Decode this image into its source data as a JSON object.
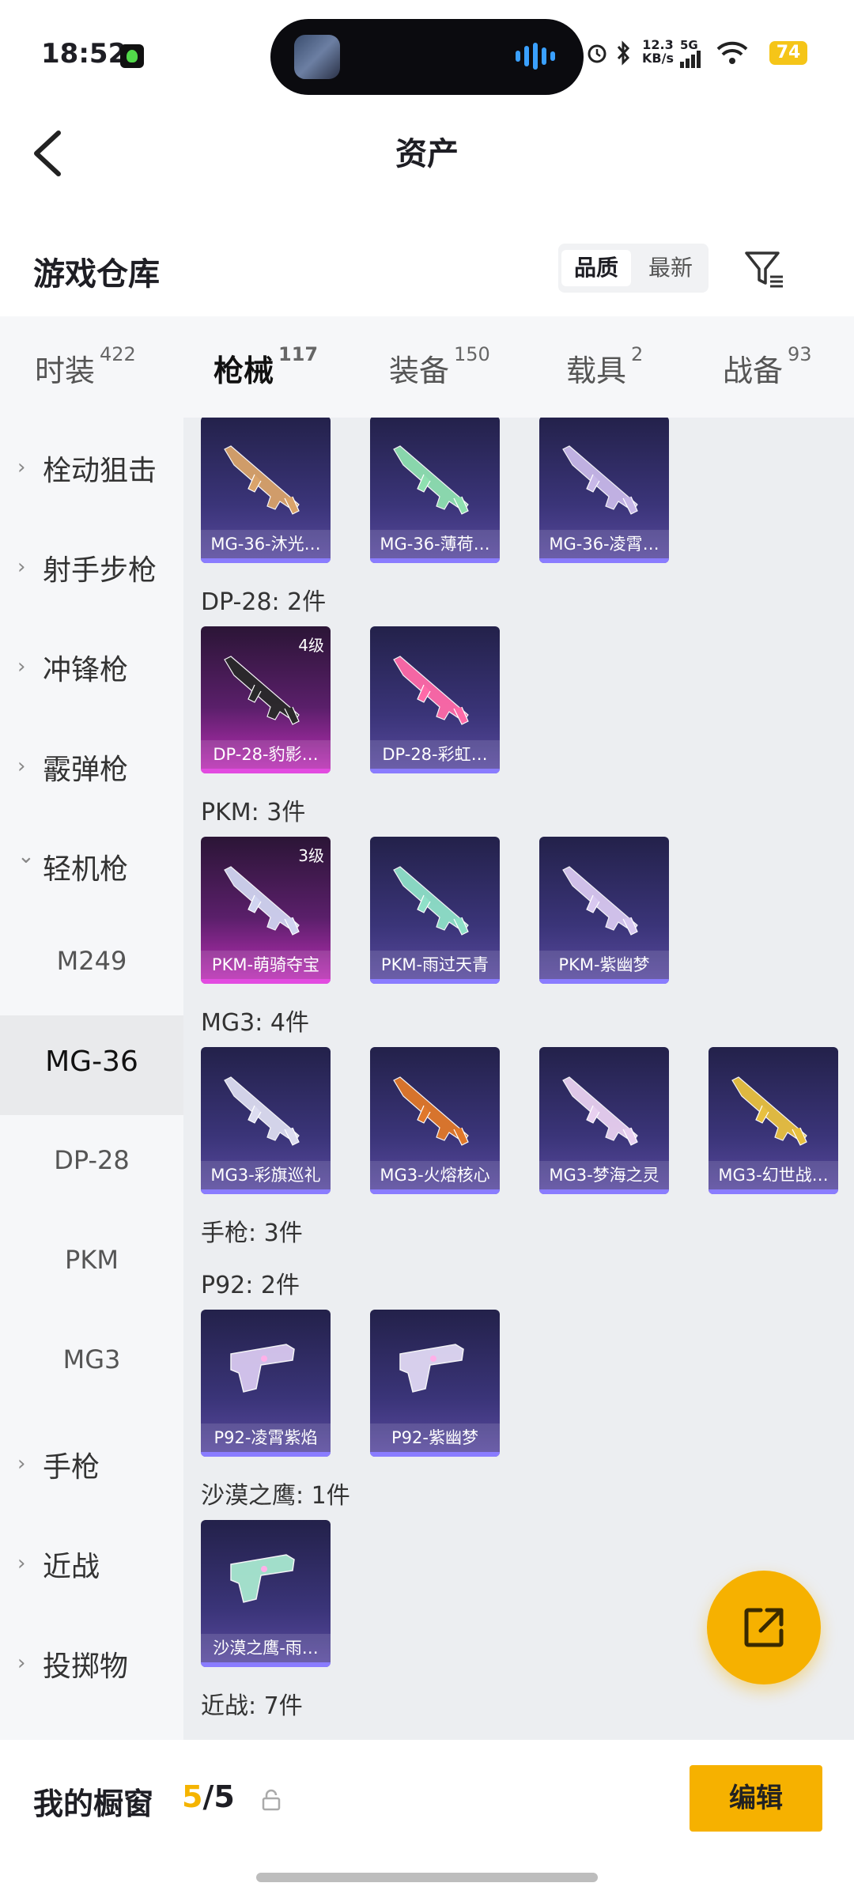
{
  "status": {
    "time": "18:52",
    "net_speed_top": "12.3",
    "net_speed_unit": "KB/s",
    "net_type": "5G",
    "battery": "74"
  },
  "header": {
    "title": "资产"
  },
  "warehouse": {
    "title": "游戏仓库",
    "sort_quality": "品质",
    "sort_newest": "最新"
  },
  "category_tabs": [
    {
      "label": "时装",
      "count": "422",
      "active": false
    },
    {
      "label": "枪械",
      "count": "117",
      "active": true
    },
    {
      "label": "装备",
      "count": "150",
      "active": false
    },
    {
      "label": "载具",
      "count": "2",
      "active": false
    },
    {
      "label": "战备",
      "count": "93",
      "active": false
    }
  ],
  "sidebar": [
    {
      "label": "栓动狙击",
      "type": "group",
      "expanded": false
    },
    {
      "label": "射手步枪",
      "type": "group",
      "expanded": false
    },
    {
      "label": "冲锋枪",
      "type": "group",
      "expanded": false
    },
    {
      "label": "霰弹枪",
      "type": "group",
      "expanded": false
    },
    {
      "label": "轻机枪",
      "type": "group",
      "expanded": true
    },
    {
      "label": "M249",
      "type": "sub"
    },
    {
      "label": "MG-36",
      "type": "sub",
      "active": true
    },
    {
      "label": "DP-28",
      "type": "sub"
    },
    {
      "label": "PKM",
      "type": "sub"
    },
    {
      "label": "MG3",
      "type": "sub"
    },
    {
      "label": "手枪",
      "type": "group",
      "expanded": false
    },
    {
      "label": "近战",
      "type": "group",
      "expanded": false
    },
    {
      "label": "投掷物",
      "type": "group",
      "expanded": false
    }
  ],
  "groups": [
    {
      "header": "",
      "items": [
        {
          "name": "MG-36-沐光…",
          "level": "",
          "rarity": "purple",
          "tone": "#d9a36a"
        },
        {
          "name": "MG-36-薄荷…",
          "level": "",
          "rarity": "purple",
          "tone": "#8fe0b0"
        },
        {
          "name": "MG-36-凌霄…",
          "level": "",
          "rarity": "purple",
          "tone": "#c8b8e8"
        }
      ]
    },
    {
      "header": "DP-28: 2件",
      "items": [
        {
          "name": "DP-28-豹影…",
          "level": "4级",
          "rarity": "pink",
          "tone": "#2a2a2a"
        },
        {
          "name": "DP-28-彩虹…",
          "level": "",
          "rarity": "purple",
          "tone": "#ff6aa8"
        }
      ]
    },
    {
      "header": "PKM: 3件",
      "items": [
        {
          "name": "PKM-萌骑夺宝",
          "level": "3级",
          "rarity": "pink",
          "tone": "#d0d4f0"
        },
        {
          "name": "PKM-雨过天青",
          "level": "",
          "rarity": "purple",
          "tone": "#8fe0c8"
        },
        {
          "name": "PKM-紫幽梦",
          "level": "",
          "rarity": "purple",
          "tone": "#d8c8f0"
        }
      ]
    },
    {
      "header": "MG3: 4件",
      "items": [
        {
          "name": "MG3-彩旗巡礼",
          "level": "",
          "rarity": "purple",
          "tone": "#dcdcf0"
        },
        {
          "name": "MG3-火熔核心",
          "level": "",
          "rarity": "purple",
          "tone": "#e0782a"
        },
        {
          "name": "MG3-梦海之灵",
          "level": "",
          "rarity": "purple",
          "tone": "#e8d0f0"
        },
        {
          "name": "MG3-幻世战…",
          "level": "",
          "rarity": "purple",
          "tone": "#e8c040"
        }
      ]
    },
    {
      "header": "手枪: 3件",
      "items": []
    },
    {
      "header": "P92: 2件",
      "items": [
        {
          "name": "P92-凌霄紫焰",
          "level": "",
          "rarity": "purple",
          "tone": "#d8c8f0"
        },
        {
          "name": "P92-紫幽梦",
          "level": "",
          "rarity": "purple",
          "tone": "#e0d8f4"
        }
      ]
    },
    {
      "header": "沙漠之鹰: 1件",
      "items": [
        {
          "name": "沙漠之鹰-雨…",
          "level": "",
          "rarity": "purple",
          "tone": "#a8e8d0"
        }
      ]
    },
    {
      "header": "近战: 7件",
      "items": []
    }
  ],
  "bottom": {
    "label": "我的橱窗",
    "count_used": "5",
    "count_sep_total": "/5",
    "edit": "编辑"
  },
  "colors": {
    "accent": "#f6b100",
    "purple_card": "#3a3478",
    "pink_card": "#c02fb8"
  }
}
